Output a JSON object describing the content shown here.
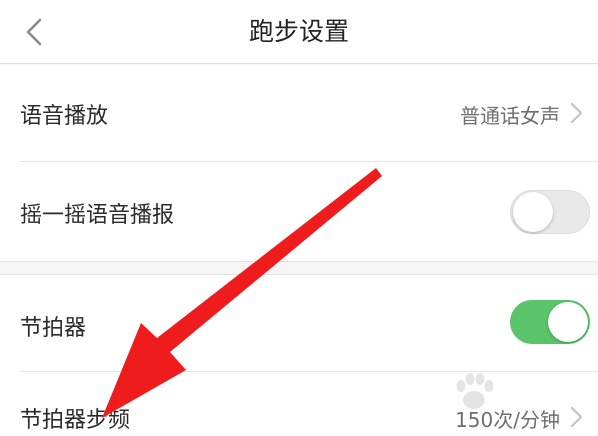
{
  "nav": {
    "title": "跑步设置"
  },
  "settings": {
    "voice_broadcast": {
      "label": "语音播放",
      "value": "普通话女声"
    },
    "shake_voice": {
      "label": "摇一摇语音播报",
      "enabled": false
    },
    "metronome": {
      "label": "节拍器",
      "enabled": true
    },
    "metronome_cadence": {
      "label": "节拍器步频",
      "value": "150次/分钟"
    }
  },
  "colors": {
    "toggle_on": "#5ac46a",
    "toggle_off": "#e9e9e9",
    "annotation_arrow": "#ee1c1c"
  },
  "icons": {
    "back": "chevron-left-icon",
    "row_arrow": "chevron-right-icon"
  }
}
